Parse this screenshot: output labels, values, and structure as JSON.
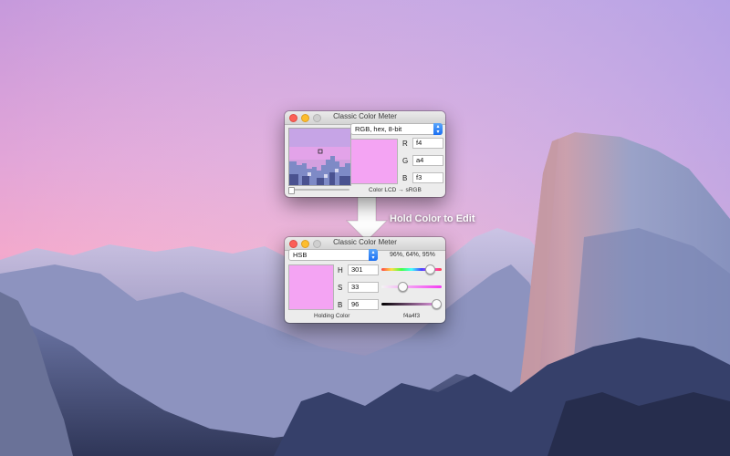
{
  "arrow_label": "Hold Color to Edit",
  "top_window": {
    "title": "Classic Color Meter",
    "format_select": "RGB, hex, 8-bit",
    "channels": [
      {
        "label": "R",
        "value": "f4"
      },
      {
        "label": "G",
        "value": "a4"
      },
      {
        "label": "B",
        "value": "f3"
      }
    ],
    "swatch_color": "#f4a4f3",
    "status": "Color LCD → sRGB"
  },
  "bottom_window": {
    "title": "Classic Color Meter",
    "format_select": "HSB",
    "summary": "96%, 64%, 95%",
    "channels": [
      {
        "label": "H",
        "value": "301",
        "slider_fraction": 0.84
      },
      {
        "label": "S",
        "value": "33",
        "slider_fraction": 0.33
      },
      {
        "label": "B",
        "value": "96",
        "slider_fraction": 0.96
      }
    ],
    "swatch_color": "#f4a4f3",
    "status_left": "Holding Color",
    "status_right": "f4a4f3"
  },
  "colors": {
    "sky_top": "#c48fd8",
    "sky_bottom": "#f0aacb",
    "rock": "#7f8fba",
    "select_accent": "#1b6ff2"
  }
}
